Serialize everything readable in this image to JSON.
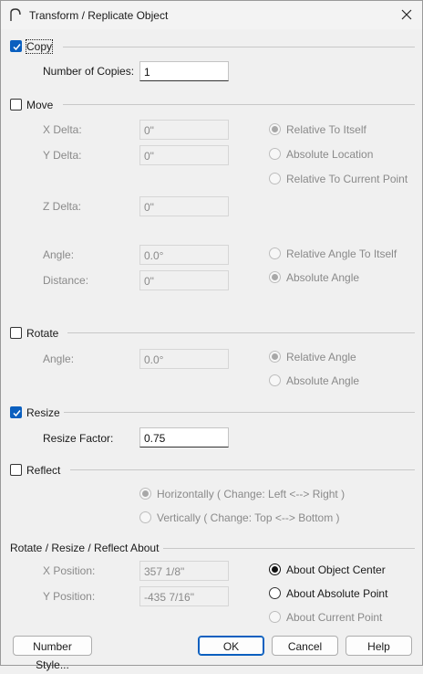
{
  "window": {
    "title": "Transform / Replicate Object"
  },
  "copy": {
    "label": "Copy",
    "checked": true,
    "num_copies_label": "Number of Copies:",
    "num_copies_value": "1"
  },
  "move": {
    "label": "Move",
    "checked": false,
    "x_label": "X Delta:",
    "x_value": "0\"",
    "y_label": "Y Delta:",
    "y_value": "0\"",
    "z_label": "Z Delta:",
    "z_value": "0\"",
    "angle_label": "Angle:",
    "angle_value": "0.0°",
    "distance_label": "Distance:",
    "distance_value": "0\"",
    "rel_itself": "Relative To Itself",
    "abs_location": "Absolute Location",
    "rel_current": "Relative To Current Point",
    "rel_angle_itself": "Relative Angle To Itself",
    "abs_angle": "Absolute Angle"
  },
  "rotate": {
    "label": "Rotate",
    "checked": false,
    "angle_label": "Angle:",
    "angle_value": "0.0°",
    "rel_angle": "Relative Angle",
    "abs_angle": "Absolute Angle"
  },
  "resize": {
    "label": "Resize",
    "checked": true,
    "factor_label": "Resize Factor:",
    "factor_value": "0.75"
  },
  "reflect": {
    "label": "Reflect",
    "checked": false,
    "horizontal": "Horizontally ( Change: Left <--> Right )",
    "vertical": "Vertically ( Change: Top <--> Bottom )"
  },
  "about": {
    "label": "Rotate / Resize / Reflect About",
    "x_label": "X Position:",
    "x_value": "357 1/8\"",
    "y_label": "Y Position:",
    "y_value": "-435 7/16\"",
    "center": "About Object Center",
    "absolute": "About Absolute Point",
    "current": "About Current Point"
  },
  "buttons": {
    "number_style": "Number Style...",
    "ok": "OK",
    "cancel": "Cancel",
    "help": "Help"
  },
  "colors": {
    "accent": "#0a5fbf",
    "dim_text": "#8a8a8a"
  }
}
